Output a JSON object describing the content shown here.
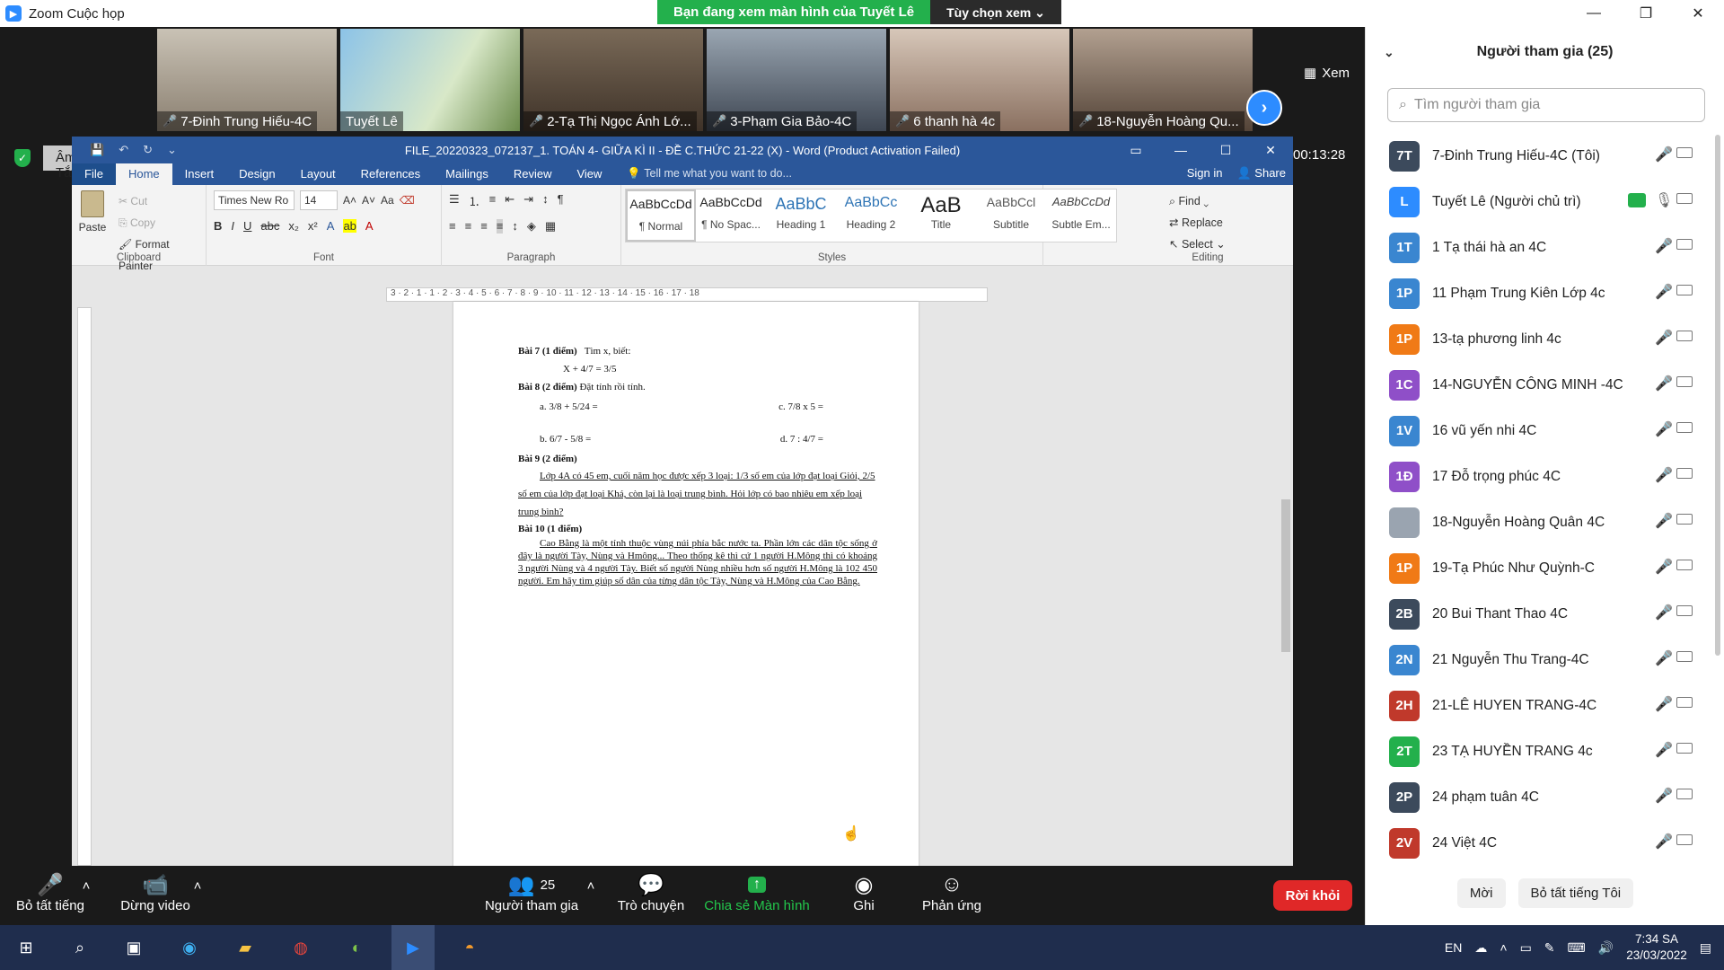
{
  "zoom": {
    "window_title": "Zoom Cuộc họp",
    "share_banner": "Bạn đang xem màn hình của Tuyết Lê",
    "view_options": "Tùy chọn xem",
    "view_label": "Xem",
    "audio_tooltip": "Âm thanh gốc: Tắt",
    "timer": "00:13:28",
    "tiles": [
      {
        "name": "7-Đinh Trung Hiếu-4C"
      },
      {
        "name": "Tuyết Lê"
      },
      {
        "name": "2-Tạ Thị Ngọc Ánh Lớ..."
      },
      {
        "name": "3-Phạm Gia Bảo-4C"
      },
      {
        "name": "6 thanh hà 4c"
      },
      {
        "name": "18-Nguyễn Hoàng Qu..."
      }
    ],
    "toolbar": {
      "mute_all": "Bỏ tất tiếng",
      "stop_video": "Dừng video",
      "participants": "Người tham gia",
      "participants_count": "25",
      "chat": "Trò chuyện",
      "share_screen": "Chia sẻ Màn hình",
      "record": "Ghi",
      "reactions": "Phản ứng",
      "leave": "Rời khỏi"
    },
    "panel": {
      "title": "Người tham gia (25)",
      "search_placeholder": "Tìm người tham gia",
      "invite": "Mời",
      "mute_me": "Bỏ tất tiếng Tôi",
      "participants": [
        {
          "initials": "7T",
          "name": "7-Đinh Trung Hiếu-4C (Tôi)",
          "color": "#3c4a5c"
        },
        {
          "initials": "L",
          "name": "Tuyết Lê (Người chủ trì)",
          "color": "#2d8cff"
        },
        {
          "initials": "1T",
          "name": "1 Tạ thái hà an 4C",
          "color": "#3a86d0"
        },
        {
          "initials": "1P",
          "name": "11 Phạm Trung Kiên Lớp 4c",
          "color": "#3a86d0"
        },
        {
          "initials": "1P",
          "name": "13-tạ phương linh 4c",
          "color": "#f07a16"
        },
        {
          "initials": "1C",
          "name": "14-NGUYỄN CÔNG MINH -4C",
          "color": "#8f4fc8"
        },
        {
          "initials": "1V",
          "name": "16 vũ yến nhi 4C",
          "color": "#3a86d0"
        },
        {
          "initials": "1Đ",
          "name": "17 Đỗ trọng phúc 4C",
          "color": "#8f4fc8"
        },
        {
          "initials": "",
          "name": "18-Nguyễn Hoàng Quân 4C",
          "color": "#9aa4b0"
        },
        {
          "initials": "1P",
          "name": "19-Tạ Phúc Như Quỳnh-C",
          "color": "#f07a16"
        },
        {
          "initials": "2B",
          "name": "20 Bui Thant Thao 4C",
          "color": "#3c4a5c"
        },
        {
          "initials": "2N",
          "name": "21 Nguyễn Thu Trang-4C",
          "color": "#3a86d0"
        },
        {
          "initials": "2H",
          "name": "21-LÊ HUYEN TRANG-4C",
          "color": "#c0392b"
        },
        {
          "initials": "2T",
          "name": "23 TẠ HUYỀN TRANG 4c",
          "color": "#23b04c"
        },
        {
          "initials": "2P",
          "name": "24 phạm tuân 4C",
          "color": "#3c4a5c"
        },
        {
          "initials": "2V",
          "name": "24 Việt 4C",
          "color": "#c0392b"
        }
      ]
    }
  },
  "word": {
    "title": "FILE_20220323_072137_1. TOÁN 4- GIỮA KÌ II - ĐỀ C.THỨC 21-22 (X) - Word (Product Activation Failed)",
    "tabs": [
      "File",
      "Home",
      "Insert",
      "Design",
      "Layout",
      "References",
      "Mailings",
      "Review",
      "View"
    ],
    "tell_me": "Tell me what you want to do...",
    "sign_in": "Sign in",
    "share": "Share",
    "clipboard": {
      "paste": "Paste",
      "cut": "Cut",
      "copy": "Copy",
      "format_painter": "Format Painter",
      "group": "Clipboard"
    },
    "font": {
      "name": "Times New Ro",
      "size": "14",
      "group": "Font"
    },
    "paragraph_group": "Paragraph",
    "styles": [
      {
        "preview": "AaBbCcDd",
        "name": "¶ Normal"
      },
      {
        "preview": "AaBbCcDd",
        "name": "¶ No Spac..."
      },
      {
        "preview": "AaBbC",
        "name": "Heading 1"
      },
      {
        "preview": "AaBbCc",
        "name": "Heading 2"
      },
      {
        "preview": "AaB",
        "name": "Title"
      },
      {
        "preview": "AaBbCcl",
        "name": "Subtitle"
      },
      {
        "preview": "AaBbCcDd",
        "name": "Subtle Em..."
      }
    ],
    "styles_group": "Styles",
    "editing": {
      "find": "Find",
      "replace": "Replace",
      "select": "Select",
      "group": "Editing"
    },
    "ruler_text": "3 · 2 · 1 · 1 · 2 · 3 · 4 · 5 · 6 · 7 · 8 · 9 · 10 · 11 · 12 · 13 · 14 · 15 · 16 · 17 · 18",
    "doc": {
      "b7_title": "Bài 7 (1 điểm)",
      "b7_text": "Tìm x, biết:",
      "b7_eq": "X + 4/7 = 3/5",
      "b8_title": "Bài 8 (2 điểm)",
      "b8_text": "Đặt tính rồi tính.",
      "b8_a": "a. 3/8 + 5/24 =",
      "b8_c": "c. 7/8 x 5 =",
      "b8_b": "b. 6/7 - 5/8 =",
      "b8_d": "d. 7 : 4/7 =",
      "b9_title": "Bài 9 (2 điểm)",
      "b9_text": "Lớp 4A có 45 em, cuối năm học được xếp 3 loại: 1/3 số em của lớp đạt loại Giỏi, 2/5 số em của lớp đạt loại Khá, còn lại là loại trung bình. Hỏi lớp có bao nhiêu em xếp loại trung bình?",
      "b10_title": "Bài 10 (1 điểm)",
      "b10_text": "Cao Bằng là một tỉnh thuộc vùng núi phía bắc nước ta. Phần lớn các dân tộc sống ở đây là người Tày, Nùng và Hmông... Theo thống kê thì cứ 1 người H.Mông thì có khoảng 3 người Nùng và 4 người Tày. Biết số người Nùng nhiều hơn số người H.Mông là 102 450 người. Em hãy tìm giúp số dân của từng dân tộc Tày, Nùng và H.Mông của Cao Bằng."
    }
  },
  "taskbar": {
    "lang": "EN",
    "time": "7:34 SA",
    "date": "23/03/2022"
  }
}
